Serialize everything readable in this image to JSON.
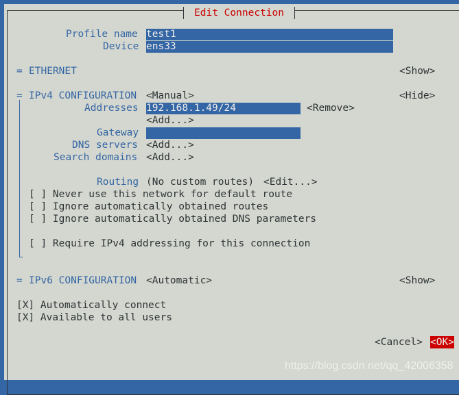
{
  "window": {
    "title": "Edit Connection"
  },
  "profile": {
    "label": "Profile name",
    "value": "test1"
  },
  "device": {
    "label": "Device",
    "value": "ens33"
  },
  "ethernet": {
    "marker": "=",
    "label": "ETHERNET",
    "toggle": "<Show>"
  },
  "ipv4": {
    "marker": "=",
    "label": "IPv4 CONFIGURATION",
    "mode": "<Manual>",
    "toggle": "<Hide>",
    "addresses_label": "Addresses",
    "address_value": "192.168.1.49/24",
    "remove": "<Remove>",
    "add_address": "<Add...>",
    "gateway_label": "Gateway",
    "gateway_value": "",
    "dns_label": "DNS servers",
    "dns_add": "<Add...>",
    "search_label": "Search domains",
    "search_add": "<Add...>",
    "routing_label": "Routing",
    "routing_value": "(No custom routes)",
    "routing_edit": "<Edit...>",
    "checks": [
      "[ ] Never use this network for default route",
      "[ ] Ignore automatically obtained routes",
      "[ ] Ignore automatically obtained DNS parameters"
    ],
    "require": "[ ] Require IPv4 addressing for this connection"
  },
  "ipv6": {
    "marker": "=",
    "label": "IPv6 CONFIGURATION",
    "mode": "<Automatic>",
    "toggle": "<Show>"
  },
  "auto_connect": "[X] Automatically connect",
  "all_users": "[X] Available to all users",
  "buttons": {
    "cancel": "<Cancel>",
    "ok": "<OK>"
  },
  "watermark": "https://blog.csdn.net/qq_42006358"
}
